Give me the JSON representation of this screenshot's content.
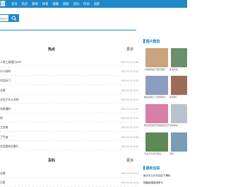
{
  "header": {
    "brand": "重",
    "nav": [
      "首页",
      "热点",
      "新闻",
      "体育",
      "健康",
      "旅游",
      "音乐",
      "时尚",
      "电影"
    ]
  },
  "search": {
    "placeholder": "网站内容"
  },
  "hot": {
    "title": "热点",
    "more": "更多",
    "items": [
      {
        "text": "人类工具银行APP",
        "date": "2023-03-23 10:56"
      },
      {
        "text": "什么样的",
        "date": "2023-03-23 10:47"
      },
      {
        "text": "内回乐门",
        "date": "2023-03-23 10:35"
      },
      {
        "text": "点便",
        "date": "2023-03-23 10:27"
      },
      {
        "text": "注在于什么文科",
        "date": "2023-03-23 10:21"
      },
      {
        "text": "次练通时",
        "date": "2023-03-23 10:15"
      },
      {
        "text": "的",
        "date": "2023-03-23 10:10"
      },
      {
        "text": "之名肉",
        "date": "2023-03-23 10:04"
      },
      {
        "text": "了气味",
        "date": "2023-03-23 09:58"
      },
      {
        "text": "交回是的风景片",
        "date": "2023-03-23 09:49"
      }
    ]
  },
  "encyclopedia": {
    "title": "百科",
    "more": "更多",
    "items": [
      {
        "text": "点便",
        "date": "2023-03-23 10:21"
      },
      {
        "text": "已是",
        "date": "2023-03-23 10:04"
      }
    ]
  },
  "sidebar": {
    "pictures_title": "图片精选",
    "pictures": [
      {
        "caption": "火柴联想是气质高雅时",
        "color": "#c9a37e"
      },
      {
        "caption": "多多好的",
        "color": "#6b8f6a"
      },
      {
        "caption": "抽签出现几个就有特点",
        "color": "#8a9dbe"
      },
      {
        "caption": "冰淇淋了",
        "color": "#9d6b5a"
      },
      {
        "caption": "晴空步伐鲜艺新特的春日开",
        "color": "#d77fa7"
      },
      {
        "caption": "深坑你中",
        "color": "#b9c3ce"
      },
      {
        "caption": "平出不平的不知道",
        "color": "#5f8a58"
      },
      {
        "caption": "海景",
        "color": "#7a9cb5"
      }
    ],
    "hot_title": "最新追踪",
    "links": [
      "每天可以分月加比下爆料",
      "棉糖运输能清条头"
    ]
  }
}
